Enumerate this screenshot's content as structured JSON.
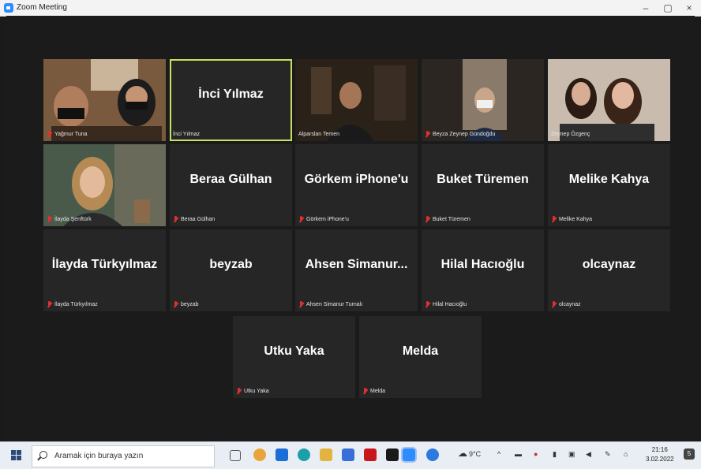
{
  "window": {
    "title": "Zoom Meeting",
    "minimize": "–",
    "maximize": "▢",
    "close": "×"
  },
  "participants": [
    {
      "name": "Yağmur Tuna",
      "label": "Yağmur Tuna",
      "video": true,
      "muted": true
    },
    {
      "name": "İnci Yılmaz",
      "label": "İnci Yılmaz",
      "video": false,
      "muted": false,
      "active_speaker": true
    },
    {
      "name": "Alparslan Temen",
      "label": "Alparslan Temen",
      "video": true,
      "muted": false
    },
    {
      "name": "Beyza Zeynep Gündoğdu",
      "label": "Beyza Zeynep Gündoğdu",
      "video": true,
      "muted": true
    },
    {
      "name": "Zeynep Özgenç",
      "label": "Zeynep Özgenç",
      "video": true,
      "muted": false
    },
    {
      "name": "İlayda Şenftürk",
      "label": "İlayda Şenftürk",
      "video": true,
      "muted": true
    },
    {
      "name": "Beraa Gülhan",
      "label": "Beraa Gülhan",
      "video": false,
      "muted": true
    },
    {
      "name": "Görkem iPhone'u",
      "label": "Görkem iPhone'u",
      "video": false,
      "muted": true
    },
    {
      "name": "Buket Türemen",
      "label": "Buket Türemen",
      "video": false,
      "muted": true
    },
    {
      "name": "Melike Kahya",
      "label": "Melike Kahya",
      "video": false,
      "muted": true
    },
    {
      "name": "İlayda Türkyılmaz",
      "label": "İlayda Türkyılmaz",
      "video": false,
      "muted": true
    },
    {
      "name": "beyzab",
      "label": "beyzab",
      "video": false,
      "muted": true
    },
    {
      "name": "Ahsen  Simanur...",
      "label": "Ahsen Simanur Turnalı",
      "video": false,
      "muted": true
    },
    {
      "name": "Hilal Hacıoğlu",
      "label": "Hilal Hacıoğlu",
      "video": false,
      "muted": true
    },
    {
      "name": "olcaynaz",
      "label": "olcaynaz",
      "video": false,
      "muted": true
    },
    {
      "name": "Utku Yaka",
      "label": "Utku Yaka",
      "video": false,
      "muted": true
    },
    {
      "name": "Melda",
      "label": "Melda",
      "video": false,
      "muted": true
    }
  ],
  "taskbar": {
    "search_placeholder": "Aramak için buraya yazın",
    "weather": "9°C",
    "time": "21:16",
    "date": "3.02.2022",
    "notification_count": "5"
  },
  "colors": {
    "active_speaker": "#c8e25b",
    "mute": "#e0312e",
    "tile": "#262626"
  }
}
